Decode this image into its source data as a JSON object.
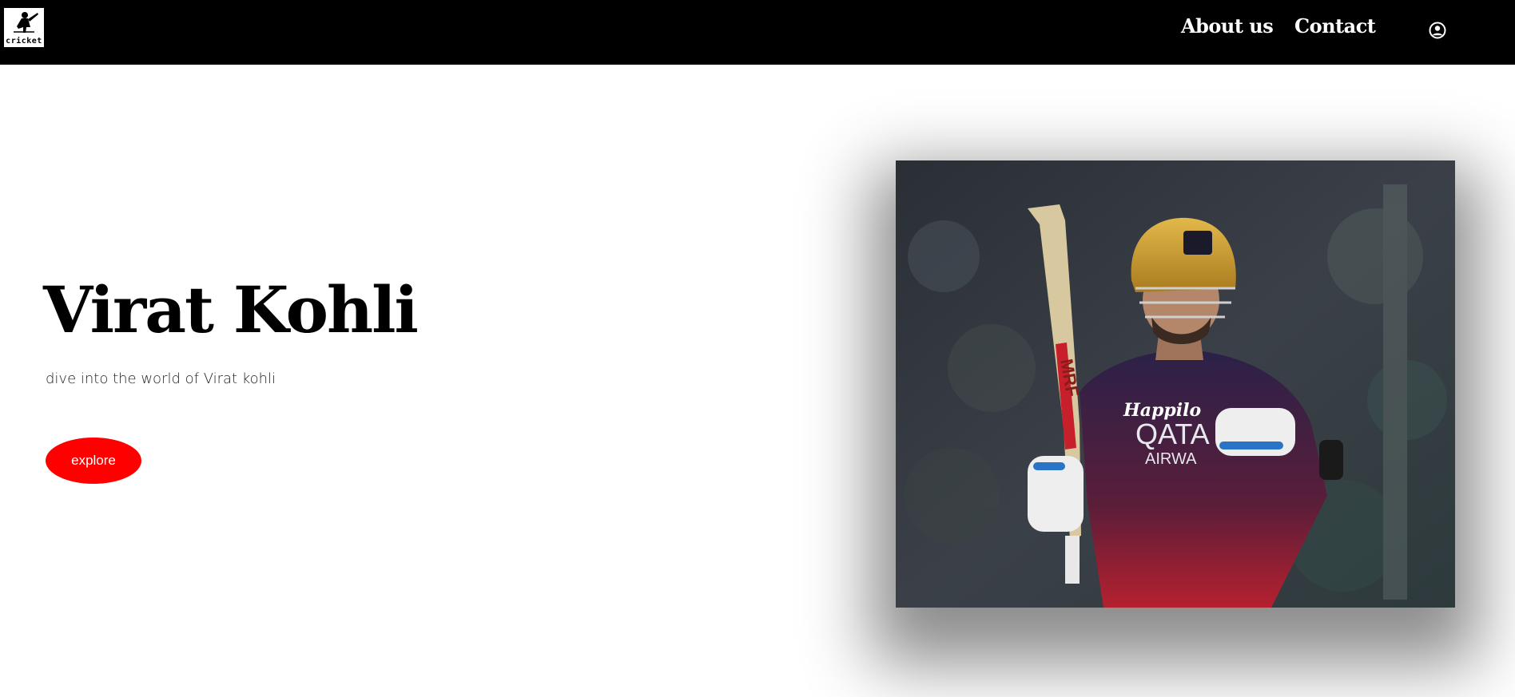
{
  "header": {
    "logo_text": "cricket",
    "nav": [
      {
        "label": "About us"
      },
      {
        "label": "Contact"
      }
    ],
    "user_icon": "user-circle-icon"
  },
  "hero": {
    "title": "Virat Kohli",
    "subtitle": "dive into the world of Virat kohli",
    "cta_label": "explore"
  },
  "photo": {
    "sponsor_text": "Happilo",
    "jersey_line1": "QATA",
    "jersey_line2": "AIRWA",
    "bat_brand": "MRF"
  },
  "colors": {
    "navbar": "#000000",
    "accent": "#ff0000",
    "background": "#ffffff"
  }
}
